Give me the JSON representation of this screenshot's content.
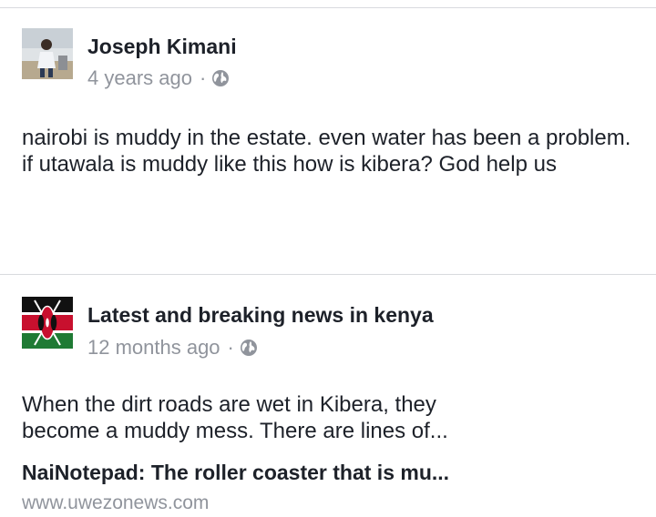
{
  "posts": [
    {
      "author": "Joseph Kimani",
      "time": "4 years ago",
      "separator": "·",
      "audience_icon": "globe-icon",
      "text": "nairobi is muddy in the estate. even water has been a problem. if utawala is muddy like this how is kibera? God help us"
    },
    {
      "author": "Latest and breaking news in kenya",
      "time": "12 months ago",
      "separator": "·",
      "audience_icon": "globe-icon",
      "text": "When the dirt roads are wet in Kibera, they become a muddy mess. There are lines of...",
      "link": {
        "title": "NaiNotepad: The roller coaster that is mu...",
        "domain": "www.uwezonews.com"
      }
    }
  ],
  "colors": {
    "text": "#1d2129",
    "muted": "#90949c",
    "divider": "#d8dade"
  }
}
